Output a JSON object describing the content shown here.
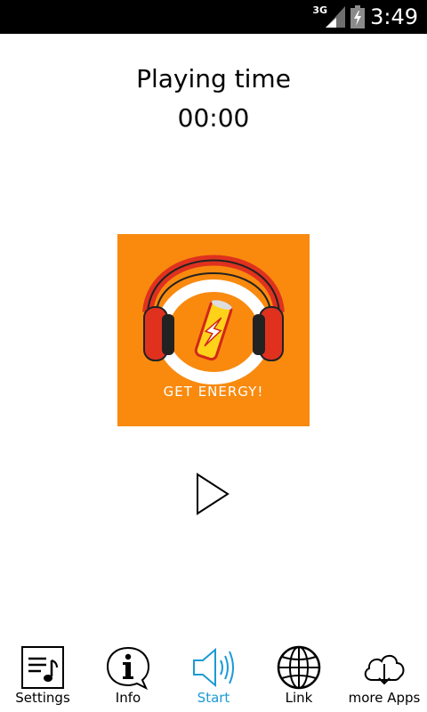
{
  "status_bar": {
    "network": "3G",
    "time": "3:49"
  },
  "player": {
    "title": "Playing time",
    "time": "00:00",
    "cover_text": "GET ENERGY!"
  },
  "tabs": [
    {
      "label": "Settings",
      "icon": "settings-music-icon",
      "active": false
    },
    {
      "label": "Info",
      "icon": "info-bubble-icon",
      "active": false
    },
    {
      "label": "Start",
      "icon": "speaker-icon",
      "active": true
    },
    {
      "label": "Link",
      "icon": "globe-icon",
      "active": false
    },
    {
      "label": "more Apps",
      "icon": "cloud-download-icon",
      "active": false
    }
  ],
  "colors": {
    "accent": "#1a9ad6",
    "cover_bg": "#f98a0e",
    "headphone_red": "#e0311f"
  }
}
